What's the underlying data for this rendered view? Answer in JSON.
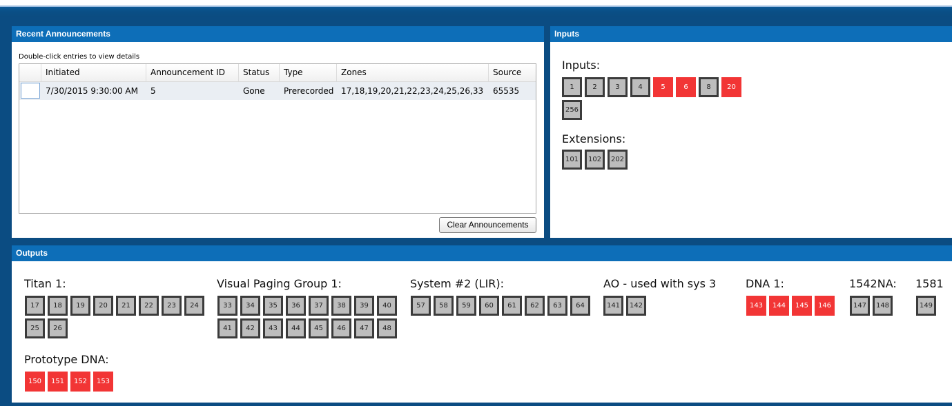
{
  "recent": {
    "title": "Recent Announcements",
    "hint": "Double-click entries to view details",
    "columns": [
      "Initiated",
      "Announcement ID",
      "Status",
      "Type",
      "Zones",
      "Source"
    ],
    "rows": [
      {
        "initiated": "7/30/2015 9:30:00 AM",
        "id": "5",
        "status": "Gone",
        "type": "Prerecorded",
        "zones": "17,18,19,20,21,22,23,24,25,26,33",
        "source": "65535"
      }
    ],
    "clear_label": "Clear Announcements"
  },
  "inputs": {
    "title": "Inputs",
    "groups": [
      {
        "label": "Inputs:",
        "chips": [
          {
            "n": "1",
            "active": false
          },
          {
            "n": "2",
            "active": false
          },
          {
            "n": "3",
            "active": false
          },
          {
            "n": "4",
            "active": false
          },
          {
            "n": "5",
            "active": true
          },
          {
            "n": "6",
            "active": true
          },
          {
            "n": "8",
            "active": false
          },
          {
            "n": "20",
            "active": true
          },
          {
            "n": "256",
            "active": false
          }
        ]
      },
      {
        "label": "Extensions:",
        "chips": [
          {
            "n": "101",
            "active": false
          },
          {
            "n": "102",
            "active": false
          },
          {
            "n": "202",
            "active": false
          }
        ]
      }
    ]
  },
  "outputs": {
    "title": "Outputs",
    "groups": [
      {
        "label": "Titan 1:",
        "chips": [
          {
            "n": "17",
            "active": false
          },
          {
            "n": "18",
            "active": false
          },
          {
            "n": "19",
            "active": false
          },
          {
            "n": "20",
            "active": false
          },
          {
            "n": "21",
            "active": false
          },
          {
            "n": "22",
            "active": false
          },
          {
            "n": "23",
            "active": false
          },
          {
            "n": "24",
            "active": false
          },
          {
            "n": "25",
            "active": false
          },
          {
            "n": "26",
            "active": false
          }
        ]
      },
      {
        "label": "Visual Paging Group 1:",
        "chips": [
          {
            "n": "33",
            "active": false
          },
          {
            "n": "34",
            "active": false
          },
          {
            "n": "35",
            "active": false
          },
          {
            "n": "36",
            "active": false
          },
          {
            "n": "37",
            "active": false
          },
          {
            "n": "38",
            "active": false
          },
          {
            "n": "39",
            "active": false
          },
          {
            "n": "40",
            "active": false
          },
          {
            "n": "41",
            "active": false
          },
          {
            "n": "42",
            "active": false
          },
          {
            "n": "43",
            "active": false
          },
          {
            "n": "44",
            "active": false
          },
          {
            "n": "45",
            "active": false
          },
          {
            "n": "46",
            "active": false
          },
          {
            "n": "47",
            "active": false
          },
          {
            "n": "48",
            "active": false
          }
        ]
      },
      {
        "label": "System #2 (LIR):",
        "chips": [
          {
            "n": "57",
            "active": false
          },
          {
            "n": "58",
            "active": false
          },
          {
            "n": "59",
            "active": false
          },
          {
            "n": "60",
            "active": false
          },
          {
            "n": "61",
            "active": false
          },
          {
            "n": "62",
            "active": false
          },
          {
            "n": "63",
            "active": false
          },
          {
            "n": "64",
            "active": false
          }
        ]
      },
      {
        "label": "AO - used with sys 3",
        "chips": [
          {
            "n": "141",
            "active": false
          },
          {
            "n": "142",
            "active": false
          }
        ]
      },
      {
        "label": "DNA 1:",
        "chips": [
          {
            "n": "143",
            "active": true
          },
          {
            "n": "144",
            "active": true
          },
          {
            "n": "145",
            "active": true
          },
          {
            "n": "146",
            "active": true
          }
        ]
      },
      {
        "label": "1542NA:",
        "chips": [
          {
            "n": "147",
            "active": false
          },
          {
            "n": "148",
            "active": false
          }
        ]
      },
      {
        "label": "1581",
        "chips": [
          {
            "n": "149",
            "active": false
          }
        ]
      },
      {
        "label": "Prototype DNA:",
        "chips": [
          {
            "n": "150",
            "active": true
          },
          {
            "n": "151",
            "active": true
          },
          {
            "n": "152",
            "active": true
          },
          {
            "n": "153",
            "active": true
          }
        ]
      }
    ]
  },
  "colors": {
    "header_blue": "#0d6eb8",
    "frame_blue": "#0b4c82",
    "active_red": "#f23535",
    "idle_grey": "#bdbdbd"
  }
}
